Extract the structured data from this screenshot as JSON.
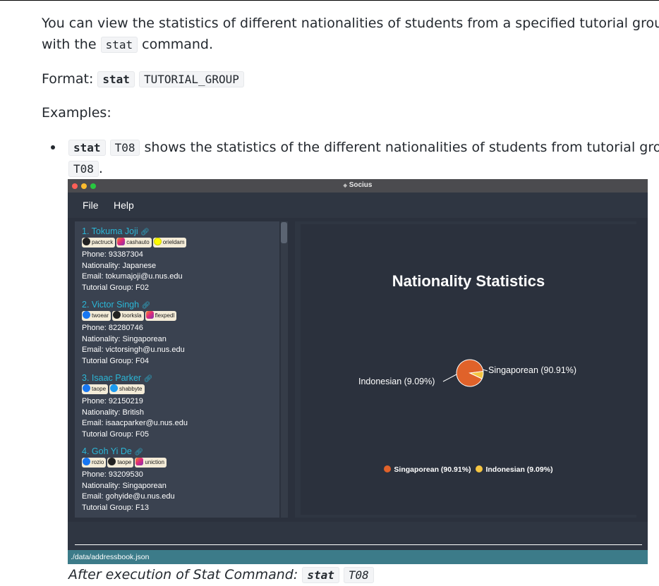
{
  "doc": {
    "intro_1": "You can view the statistics of different nationalities of students from a specified tutorial group",
    "intro_2a": "with the ",
    "intro_cmd": "stat",
    "intro_2b": " command.",
    "format_label": "Format: ",
    "format_cmd": "stat",
    "format_arg": "TUTORIAL_GROUP",
    "examples_label": "Examples:",
    "example_cmd": "stat",
    "example_arg": "T08",
    "example_text": " shows the statistics of the different nationalities of students from tutorial group",
    "example_group": "T08",
    "example_end": ".",
    "caption_text": "After execution of Stat Command: ",
    "caption_cmd": "stat",
    "caption_arg": "T08"
  },
  "app": {
    "title": "Socius",
    "menu": [
      "File",
      "Help"
    ],
    "persons": [
      {
        "name": "1. Tokuma Joji",
        "tags": [
          {
            "icon": "github-icon",
            "label": "pactruck"
          },
          {
            "icon": "instagram-icon",
            "label": "cashauto"
          },
          {
            "icon": "snapchat-icon",
            "label": "orieldam"
          }
        ],
        "phone": "Phone: 93387304",
        "nationality": "Nationality: Japanese",
        "email": "Email: tokumajoji@u.nus.edu",
        "tutorial": "Tutorial Group: F02"
      },
      {
        "name": "2. Victor Singh",
        "tags": [
          {
            "icon": "facebook-icon",
            "label": "twoear"
          },
          {
            "icon": "github-icon",
            "label": "loorksla"
          },
          {
            "icon": "instagram-icon",
            "label": "flexpedl"
          }
        ],
        "phone": "Phone: 82280746",
        "nationality": "Nationality: Singaporean",
        "email": "Email: victorsingh@u.nus.edu",
        "tutorial": "Tutorial Group: F04"
      },
      {
        "name": "3. Isaac Parker",
        "tags": [
          {
            "icon": "facebook-icon",
            "label": "taope"
          },
          {
            "icon": "twitter-icon",
            "label": "shabbyte"
          }
        ],
        "phone": "Phone: 92150219",
        "nationality": "Nationality: British",
        "email": "Email: isaacparker@u.nus.edu",
        "tutorial": "Tutorial Group: F05"
      },
      {
        "name": "4. Goh Yi De",
        "tags": [
          {
            "icon": "facebook-icon",
            "label": "rozio"
          },
          {
            "icon": "github-icon",
            "label": "taope"
          },
          {
            "icon": "instagram-icon",
            "label": "uniction"
          }
        ],
        "phone": "Phone: 93209530",
        "nationality": "Nationality: Singaporean",
        "email": "Email: gohyide@u.nus.edu",
        "tutorial": "Tutorial Group: F13"
      }
    ],
    "status_path": "./data/addressbook.json"
  },
  "chart_data": {
    "type": "pie",
    "title": "Nationality Statistics",
    "slices": [
      {
        "label": "Singaporean (90.91%)",
        "value": 90.91,
        "color": "#e0622a"
      },
      {
        "label": "Indonesian (9.09%)",
        "value": 9.09,
        "color": "#f5c542"
      }
    ],
    "legend": "bottom"
  }
}
